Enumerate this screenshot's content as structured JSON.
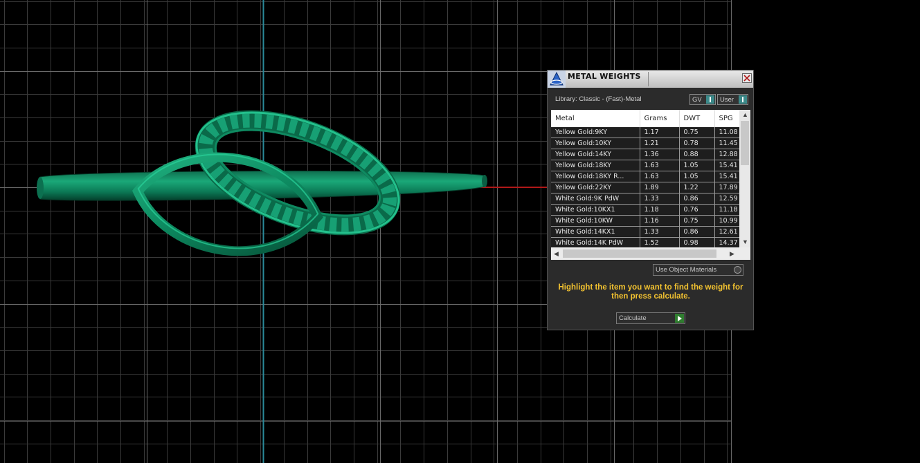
{
  "panel": {
    "title": "METAL WEIGHTS",
    "library_label": "Library: Classic - (Fast)-Metal",
    "dropdown_gv": "GV",
    "dropdown_user": "User",
    "columns": [
      "Metal",
      "Grams",
      "DWT",
      "SPG"
    ],
    "rows": [
      {
        "metal": "Yellow Gold:9KY",
        "grams": "1.17",
        "dwt": "0.75",
        "spg": "11.08"
      },
      {
        "metal": "Yellow Gold:10KY",
        "grams": "1.21",
        "dwt": "0.78",
        "spg": "11.45"
      },
      {
        "metal": "Yellow Gold:14KY",
        "grams": "1.36",
        "dwt": "0.88",
        "spg": "12.88"
      },
      {
        "metal": "Yellow Gold:18KY",
        "grams": "1.63",
        "dwt": "1.05",
        "spg": "15.41"
      },
      {
        "metal": "Yellow Gold:18KY R...",
        "grams": "1.63",
        "dwt": "1.05",
        "spg": "15.41"
      },
      {
        "metal": "Yellow Gold:22KY",
        "grams": "1.89",
        "dwt": "1.22",
        "spg": "17.89"
      },
      {
        "metal": "White Gold:9K PdW",
        "grams": "1.33",
        "dwt": "0.86",
        "spg": "12.59"
      },
      {
        "metal": "White Gold:10KX1",
        "grams": "1.18",
        "dwt": "0.76",
        "spg": "11.18"
      },
      {
        "metal": "White Gold:10KW",
        "grams": "1.16",
        "dwt": "0.75",
        "spg": "10.99"
      },
      {
        "metal": "White Gold:14KX1",
        "grams": "1.33",
        "dwt": "0.86",
        "spg": "12.61"
      },
      {
        "metal": "White Gold:14K PdW",
        "grams": "1.52",
        "dwt": "0.98",
        "spg": "14.37"
      }
    ],
    "use_object_materials": "Use Object Materials",
    "instruction": "Highlight the item you want to find the weight for then press calculate.",
    "calculate_label": "Calculate"
  },
  "colors": {
    "background": "#000000",
    "grid": "#3a3a3a",
    "axis_vertical": "#2a8a9a",
    "axis_horizontal": "#b01818",
    "ring_green": "#0e8a5e",
    "instruction_text": "#f2c230"
  },
  "icons": [
    "app-logo-icon",
    "close-icon",
    "dropdown-arrow-icon",
    "scroll-up-icon",
    "scroll-down-icon",
    "scroll-left-icon",
    "scroll-right-icon",
    "radio-icon",
    "play-arrow-icon"
  ]
}
